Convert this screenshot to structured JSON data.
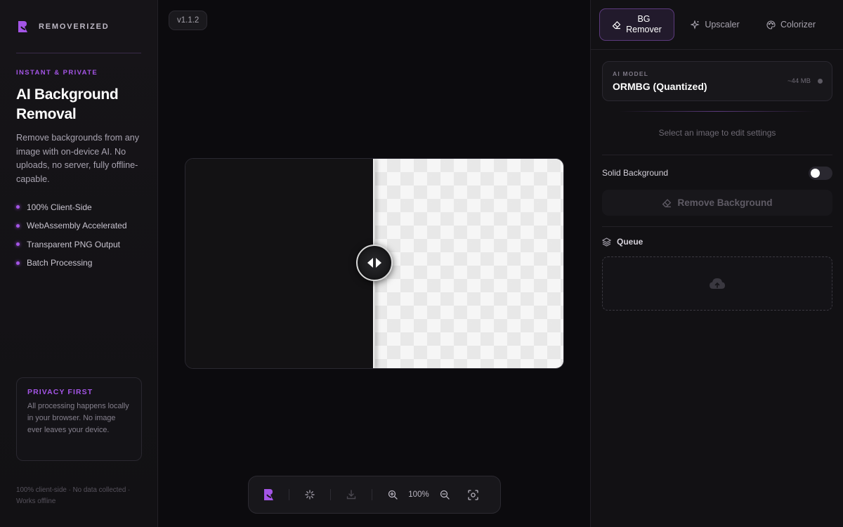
{
  "brand": {
    "name": "REMOVERIZED"
  },
  "hero": {
    "eyebrow": "INSTANT & PRIVATE",
    "headline_line1": "AI Background",
    "headline_line2": "Removal",
    "description": "Remove backgrounds from any image with on-device AI. No uploads, no server, fully offline-capable."
  },
  "features": [
    {
      "label": "100% Client-Side"
    },
    {
      "label": "WebAssembly Accelerated"
    },
    {
      "label": "Transparent PNG Output"
    },
    {
      "label": "Batch Processing"
    }
  ],
  "privacy": {
    "title": "PRIVACY FIRST",
    "text": "All processing happens locally in your browser. No image ever leaves your device."
  },
  "footnote": "100% client-side · No data collected · Works offline",
  "version": "v1.1.2",
  "compare": {
    "split": 0.5
  },
  "toolbar": {
    "zoom": "100%"
  },
  "tabs": [
    {
      "label_line1": "BG",
      "label_line2": "Remover",
      "icon": "eraser-icon",
      "active": true
    },
    {
      "label": "Upscaler",
      "icon": "sparkle-icon",
      "active": false
    },
    {
      "label": "Colorizer",
      "icon": "palette-icon",
      "active": false
    }
  ],
  "model": {
    "caption": "AI MODEL",
    "name": "ORMBG (Quantized)",
    "size": "~44 MB"
  },
  "settings": {
    "hint": "Select an image to edit settings",
    "solid_bg_label": "Solid Background",
    "solid_bg_on": false,
    "remove_label": "Remove Background"
  },
  "queue": {
    "title": "Queue",
    "drop_icon": "cloud-upload-icon"
  },
  "colors": {
    "accent": "#a455e6",
    "bg": "#0c0b0e",
    "panel": "#121114"
  }
}
